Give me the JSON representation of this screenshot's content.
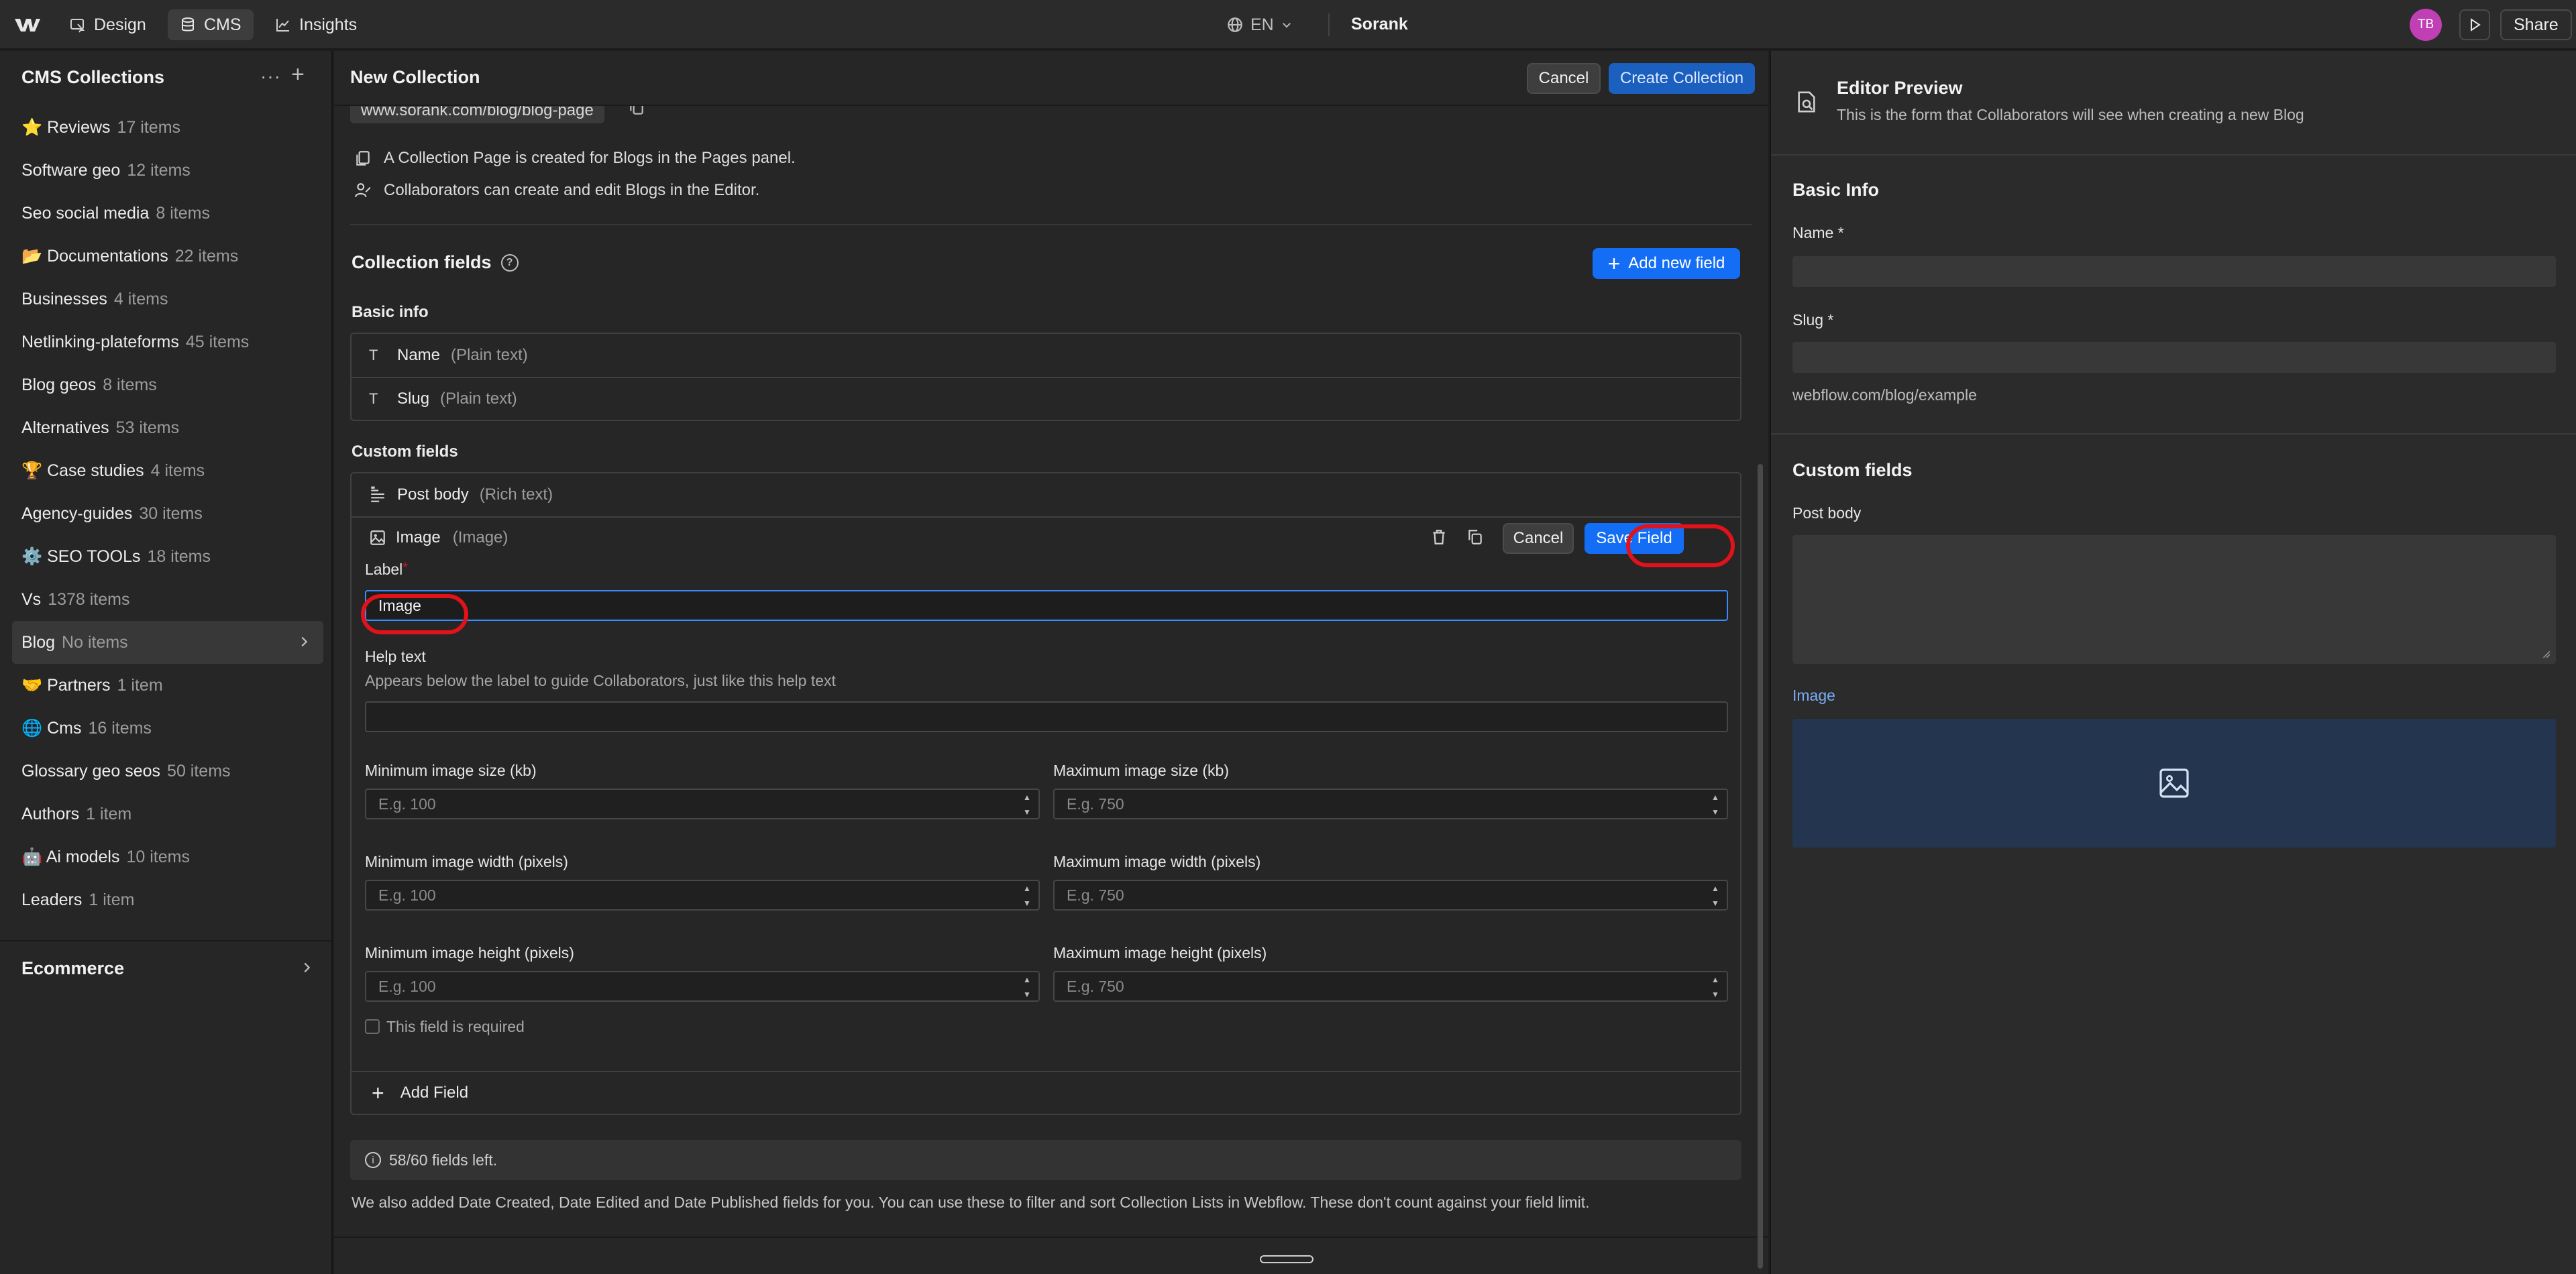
{
  "topbar": {
    "modes": [
      {
        "label": "Design",
        "icon": "design-icon"
      },
      {
        "label": "CMS",
        "icon": "database-icon"
      },
      {
        "label": "Insights",
        "icon": "chart-line-icon"
      }
    ],
    "language": "EN",
    "site_name": "Sorank",
    "avatar_initials": "TB",
    "share_label": "Share"
  },
  "sidebar": {
    "title": "CMS Collections",
    "items": [
      {
        "label": "⭐ Reviews",
        "count": "17 items"
      },
      {
        "label": "Software geo",
        "count": "12 items"
      },
      {
        "label": "Seo social media",
        "count": "8 items"
      },
      {
        "label": "📂 Documentations",
        "count": "22 items"
      },
      {
        "label": "Businesses",
        "count": "4 items"
      },
      {
        "label": "Netlinking-plateforms",
        "count": "45 items"
      },
      {
        "label": "Blog geos",
        "count": "8 items"
      },
      {
        "label": "Alternatives",
        "count": "53 items"
      },
      {
        "label": "🏆 Case studies",
        "count": "4 items"
      },
      {
        "label": "Agency-guides",
        "count": "30 items"
      },
      {
        "label": "⚙️ SEO TOOLs",
        "count": "18 items"
      },
      {
        "label": "Vs",
        "count": "1378 items"
      },
      {
        "label": "Blog",
        "count": "No items"
      },
      {
        "label": "🤝 Partners",
        "count": "1 item"
      },
      {
        "label": "🌐 Cms",
        "count": "16 items"
      },
      {
        "label": "Glossary geo seos",
        "count": "50 items"
      },
      {
        "label": "Authors",
        "count": "1 item"
      },
      {
        "label": "🤖 Ai models",
        "count": "10 items"
      },
      {
        "label": "Leaders",
        "count": "1 item"
      }
    ],
    "selected_index": 12,
    "ecommerce_label": "Ecommerce"
  },
  "center": {
    "title": "New Collection",
    "cancel_label": "Cancel",
    "create_label": "Create Collection",
    "url": "www.sorank.com/blog/blog-page",
    "info_lines": [
      "A Collection Page is created for Blogs in the Pages panel.",
      "Collaborators can create and edit Blogs in the Editor."
    ],
    "collection_fields_title": "Collection fields",
    "help_glyph": "?",
    "add_new_field_label": "Add new field",
    "basic_info_label": "Basic info",
    "basic_fields": [
      {
        "name": "Name",
        "type": "(Plain text)"
      },
      {
        "name": "Slug",
        "type": "(Plain text)"
      }
    ],
    "custom_fields_label": "Custom fields",
    "custom_fields": [
      {
        "name": "Post body",
        "type": "(Rich text)"
      }
    ],
    "editing": {
      "name": "Image",
      "type": "(Image)",
      "cancel_label": "Cancel",
      "save_label": "Save Field",
      "label_title": "Label",
      "label_value": "Image",
      "help_title": "Help text",
      "help_sub": "Appears below the label to guide Collaborators, just like this help text",
      "help_value": "",
      "limits": [
        {
          "label": "Minimum image size (kb)",
          "placeholder": "E.g. 100"
        },
        {
          "label": "Maximum image size (kb)",
          "placeholder": "E.g. 750"
        },
        {
          "label": "Minimum image width (pixels)",
          "placeholder": "E.g. 100"
        },
        {
          "label": "Maximum image width (pixels)",
          "placeholder": "E.g. 750"
        },
        {
          "label": "Minimum image height (pixels)",
          "placeholder": "E.g. 100"
        },
        {
          "label": "Maximum image height (pixels)",
          "placeholder": "E.g. 750"
        }
      ],
      "required_label": "This field is required"
    },
    "add_field_label": "Add Field",
    "fields_left": "58/60 fields left.",
    "footer_text": "We also added Date Created, Date Edited and Date Published fields for you. You can use these to filter and sort Collection Lists in Webflow. These don't count against your field limit."
  },
  "preview": {
    "title": "Editor Preview",
    "subtitle": "This is the form that Collaborators will see when creating a new Blog",
    "basic_info_title": "Basic Info",
    "name_label": "Name *",
    "slug_label": "Slug *",
    "slug_hint": "webflow.com/blog/example",
    "custom_fields_title": "Custom fields",
    "post_body_label": "Post body",
    "image_label": "Image"
  },
  "colors": {
    "accent": "#146ef5",
    "highlight_ring": "#e1121a",
    "avatar": "#c13fb4"
  }
}
